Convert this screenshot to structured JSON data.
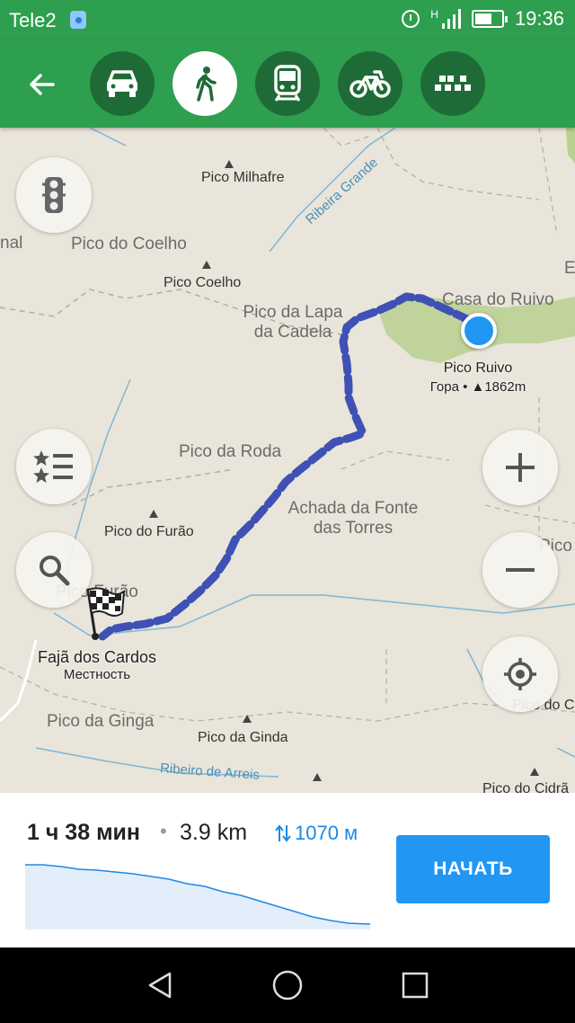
{
  "status_bar": {
    "carrier": "Tele2",
    "network": "H",
    "time": "19:36",
    "icons": [
      "location-icon",
      "alarm-icon",
      "signal-icon",
      "battery-icon"
    ]
  },
  "toolbar": {
    "back_icon": "arrow-left-icon",
    "modes": [
      {
        "name": "car",
        "icon": "car-icon",
        "active": false
      },
      {
        "name": "pedestrian",
        "icon": "walking-icon",
        "active": true
      },
      {
        "name": "transit",
        "icon": "train-icon",
        "active": false
      },
      {
        "name": "bicycle",
        "icon": "bicycle-icon",
        "active": false
      },
      {
        "name": "taxi",
        "icon": "taxi-icon",
        "active": false
      }
    ],
    "accent": "#2e9e4f",
    "dark_accent": "#1f6b37"
  },
  "map": {
    "labels": {
      "pico_milhafre": "Pico Milhafre",
      "ribeira_grande": "Ribeira Grande",
      "nal": "nal",
      "pico_do_coelho": "Pico do Coelho",
      "pico_coelho": "Pico Coelho",
      "casa_do_ruivo": "Casa do Ruivo",
      "pico_da_lapa": "Pico da Lapa\nda Cadela",
      "pico_da_roda": "Pico da Roda",
      "achada": "Achada da Fonte\ndas Torres",
      "pico_do_furao": "Pico do Furão",
      "pico_furao": "Pico Furão",
      "pico_da_ginga": "Pico da Ginga",
      "pico_da_ginda": "Pico da Ginda",
      "ribeiro_de_arreis": "Ribeiro de Arreis",
      "pico_do_cidra": "Pico do Cidrã",
      "pico_right1": "Pico",
      "pico_right2": "Pico do C",
      "e_edge": "E"
    },
    "start": {
      "name": "Pico Ruivo",
      "type": "Гора • ▲1862m"
    },
    "destination": {
      "name": "Fajã dos Cardos",
      "type": "Местность"
    },
    "route_color": "#3f51b5",
    "location_color": "#2196f3",
    "buttons": {
      "traffic": "traffic-light-icon",
      "bookmarks": "bookmarks-list-icon",
      "search": "search-icon",
      "zoom_in": "plus-icon",
      "zoom_out": "minus-icon",
      "my_position": "my-location-icon"
    }
  },
  "route_panel": {
    "time": "1 ч 38 мин",
    "separator": "•",
    "distance": "3.9 km",
    "elevation": "1070 м",
    "start_button": "НАЧАТЬ",
    "button_color": "#2196f3"
  },
  "nav_bar": {
    "back": "nav-back-icon",
    "home": "nav-home-icon",
    "recents": "nav-recents-icon"
  }
}
